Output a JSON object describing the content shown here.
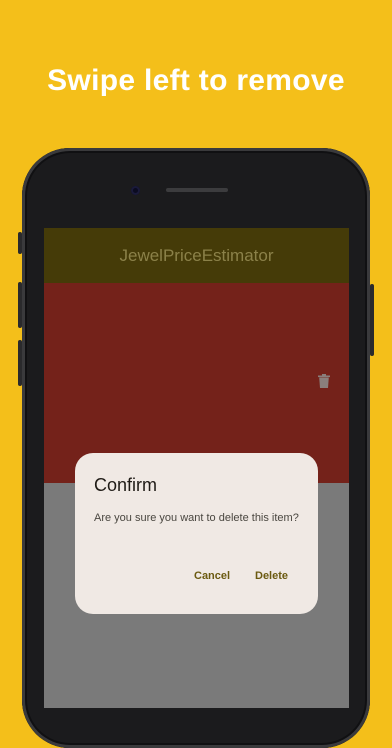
{
  "headline": "Swipe left to remove",
  "app": {
    "title": "JewelPriceEstimator"
  },
  "swipe_action": {
    "icon": "trash-icon",
    "background_color": "#74221a"
  },
  "dialog": {
    "title": "Confirm",
    "message": "Are you sure you want to delete this item?",
    "cancel_label": "Cancel",
    "delete_label": "Delete"
  },
  "colors": {
    "page_background": "#F4BF1A",
    "accent": "#6b5a10",
    "dialog_surface": "#F0E9E4"
  }
}
